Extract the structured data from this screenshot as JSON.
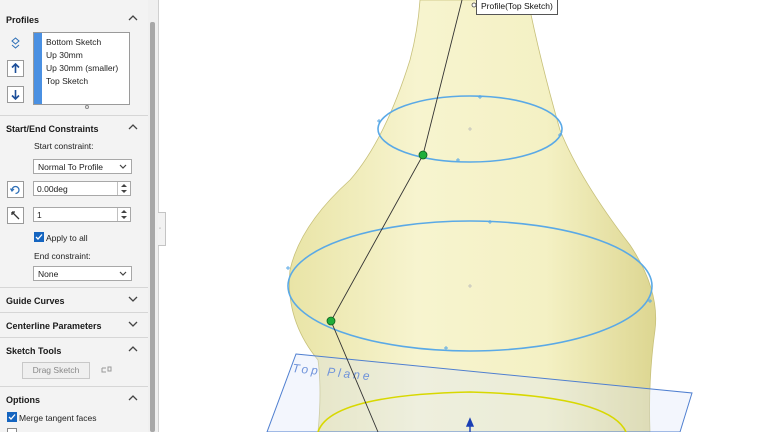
{
  "profiles": {
    "title": "Profiles",
    "items": [
      "Bottom Sketch",
      "Up 30mm",
      "Up 30mm (smaller)",
      "Top Sketch"
    ]
  },
  "constraints": {
    "title": "Start/End Constraints",
    "start_label": "Start constraint:",
    "start_value": "Normal To Profile",
    "angle_value": "0.00deg",
    "tangent_length": "1",
    "apply_all_label": "Apply to all",
    "apply_all_checked": true,
    "end_label": "End constraint:",
    "end_value": "None"
  },
  "guide_curves": {
    "title": "Guide Curves"
  },
  "centerline": {
    "title": "Centerline Parameters"
  },
  "sketch_tools": {
    "title": "Sketch Tools",
    "drag_label": "Drag Sketch"
  },
  "options": {
    "title": "Options",
    "merge_label": "Merge tangent faces",
    "merge_checked": true
  },
  "viewport": {
    "callout": "Profile(Top Sketch)",
    "plane_label": "Top Plane"
  },
  "colors": {
    "accent": "#4a90e2",
    "body": "#f4f1c4",
    "profile_curve": "#5aa9e6",
    "connector": "#1fae3a",
    "bottom_sketch": "#d8d800"
  }
}
